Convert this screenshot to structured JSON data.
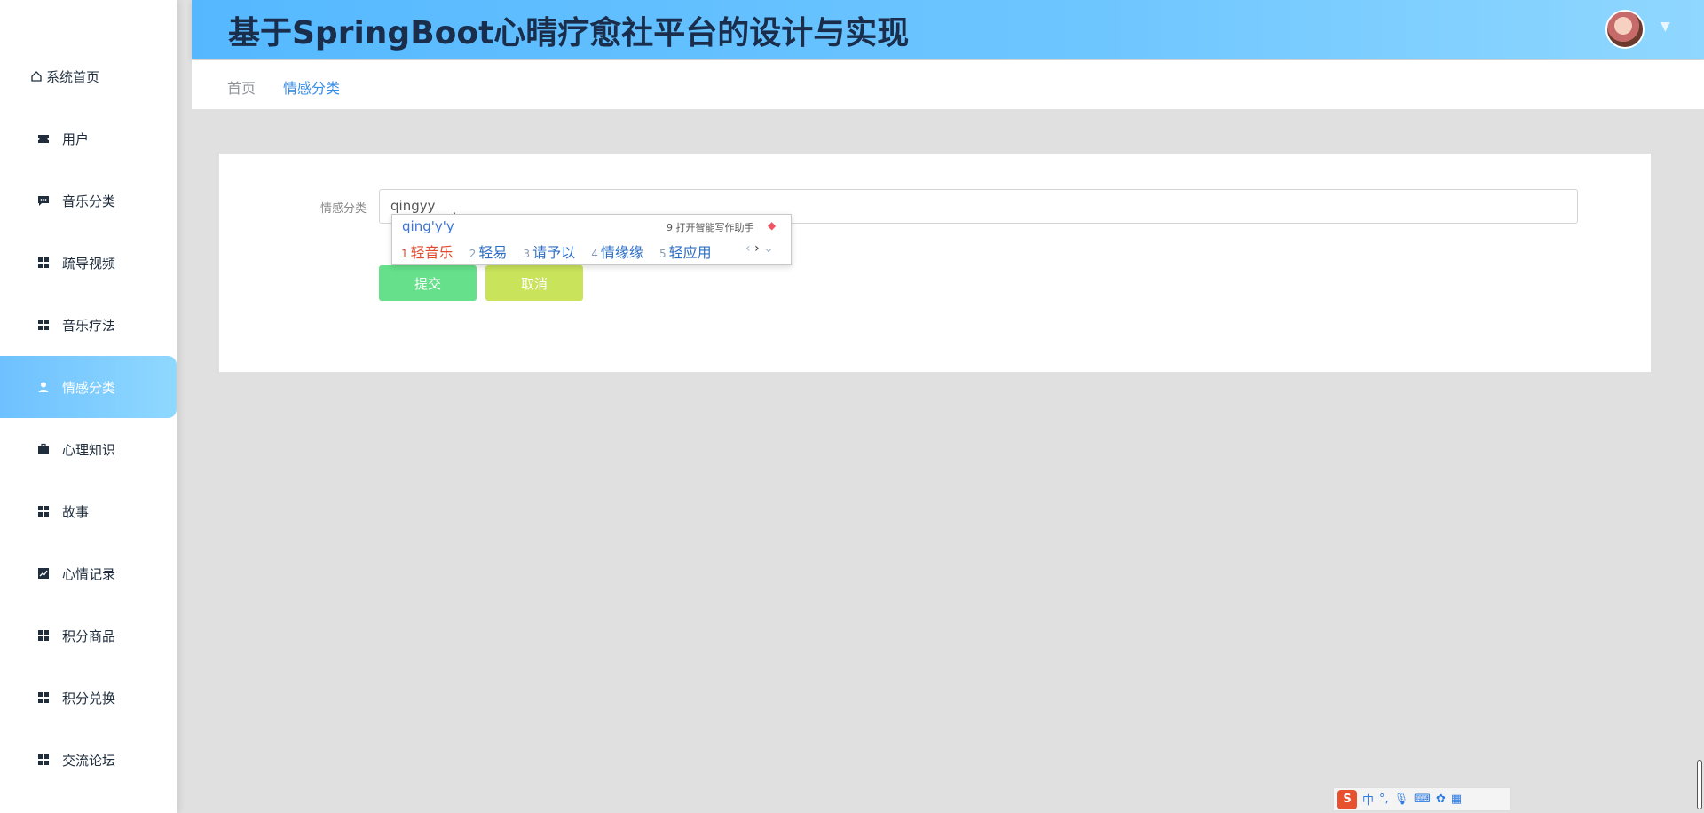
{
  "header": {
    "title": "基于SpringBoot心晴疗愈社平台的设计与实现"
  },
  "sidebar": {
    "items": [
      {
        "label": "系统首页",
        "icon": "home-icon"
      },
      {
        "label": "用户",
        "icon": "ticket-icon"
      },
      {
        "label": "音乐分类",
        "icon": "chat-icon"
      },
      {
        "label": "疏导视频",
        "icon": "grid-icon"
      },
      {
        "label": "音乐疗法",
        "icon": "grid-icon"
      },
      {
        "label": "情感分类",
        "icon": "user-icon",
        "active": true
      },
      {
        "label": "心理知识",
        "icon": "briefcase-icon"
      },
      {
        "label": "故事",
        "icon": "grid-icon"
      },
      {
        "label": "心情记录",
        "icon": "chart-icon"
      },
      {
        "label": "积分商品",
        "icon": "grid-icon"
      },
      {
        "label": "积分兑换",
        "icon": "grid-icon"
      },
      {
        "label": "交流论坛",
        "icon": "grid-icon"
      }
    ]
  },
  "breadcrumb": {
    "home": "首页",
    "current": "情感分类"
  },
  "form": {
    "label": "情感分类",
    "input_value": "qingyy",
    "submit_label": "提交",
    "cancel_label": "取消"
  },
  "ime": {
    "composition": "qing'y'y",
    "assist_text": "9 打开智能写作助手",
    "candidates": [
      {
        "num": "1",
        "text": "轻音乐"
      },
      {
        "num": "2",
        "text": "轻易"
      },
      {
        "num": "3",
        "text": "请予以"
      },
      {
        "num": "4",
        "text": "情缘缘"
      },
      {
        "num": "5",
        "text": "轻应用"
      }
    ]
  },
  "tray": {
    "logo": "S",
    "mode": "中",
    "punct": "°,"
  },
  "colors": {
    "accent": "#3a8ee6",
    "header_gradient_start": "#55b8ff",
    "submit": "#66e08a",
    "cancel": "#c9e35b",
    "sidebar_active": "#6ec1ff"
  }
}
